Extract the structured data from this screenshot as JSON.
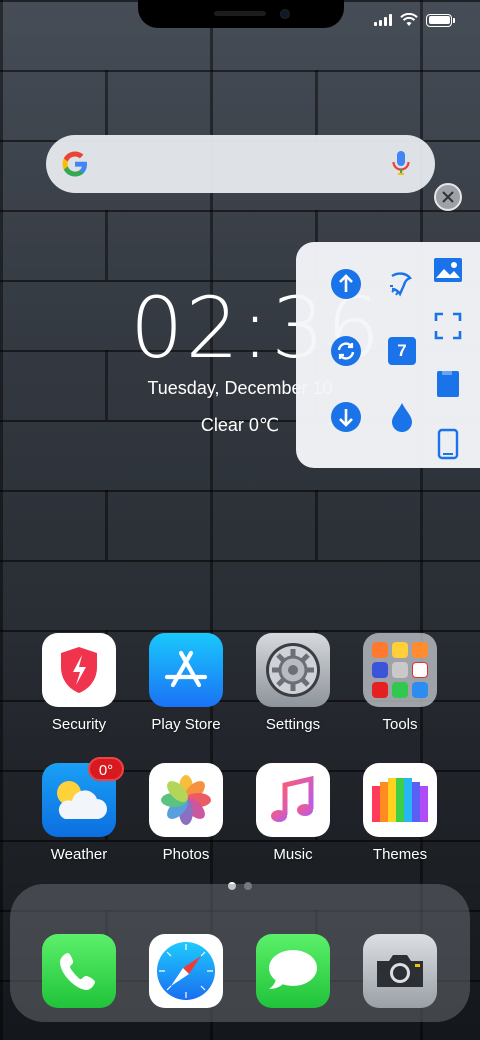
{
  "clock": {
    "time": "02:36",
    "date": "Tuesday, December 10",
    "weather": "Clear  0℃"
  },
  "search": {
    "logo": "google-g-icon",
    "mic": "mic-icon"
  },
  "status": {
    "signal": "signal-icon",
    "wifi": "wifi-icon",
    "battery": "battery-icon"
  },
  "apps": [
    {
      "label": "Security",
      "icon": "security-shield-icon"
    },
    {
      "label": "Play Store",
      "icon": "app-store-icon"
    },
    {
      "label": "Settings",
      "icon": "gear-icon"
    },
    {
      "label": "Tools",
      "icon": "tools-folder-icon"
    },
    {
      "label": "Weather",
      "icon": "weather-icon",
      "badge": "0°"
    },
    {
      "label": "Photos",
      "icon": "photos-icon"
    },
    {
      "label": "Music",
      "icon": "music-icon"
    },
    {
      "label": "Themes",
      "icon": "themes-icon"
    }
  ],
  "dock": [
    {
      "icon": "phone-icon"
    },
    {
      "icon": "safari-compass-icon"
    },
    {
      "icon": "messages-icon"
    },
    {
      "icon": "camera-icon"
    }
  ],
  "quick_tools": [
    "arrow-up-icon",
    "rotate-icon",
    "arrow-down-icon",
    "clean-icon",
    "calendar-icon",
    "water-drop-icon",
    "gallery-icon",
    "screenshot-icon",
    "book-icon",
    "phone-frame-icon"
  ],
  "calendar_day": "7",
  "page_indicator": {
    "count": 2,
    "active": 1
  },
  "colors": {
    "accent": "#1a73e8",
    "badge": "#d81920"
  }
}
